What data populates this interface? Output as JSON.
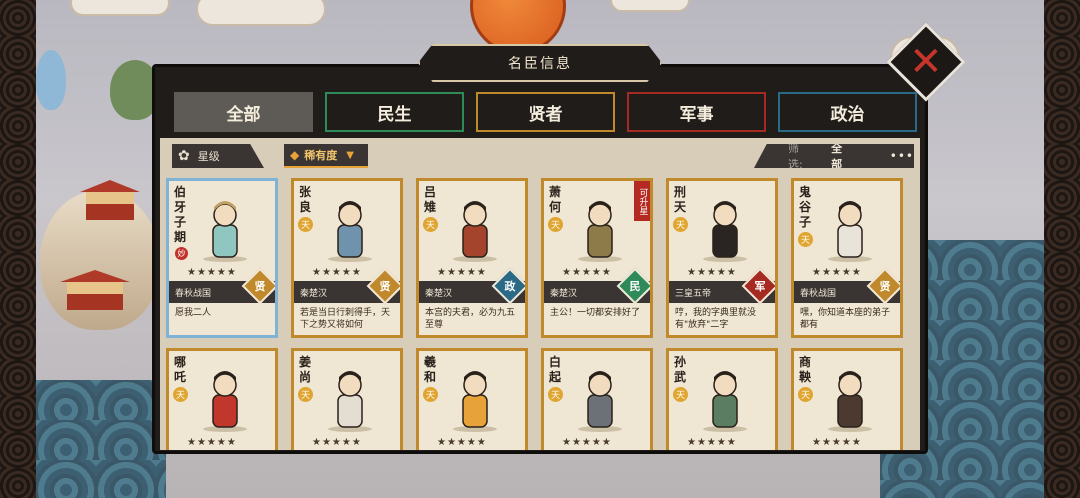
{
  "window_title": "名臣信息",
  "close_icon": "close-x-icon",
  "tabs": [
    {
      "label": "全部",
      "color": "#5e5a55",
      "active": true
    },
    {
      "label": "民生",
      "color": "#2f8a5a",
      "active": false
    },
    {
      "label": "贤者",
      "color": "#c08a2c",
      "active": false
    },
    {
      "label": "军事",
      "color": "#a52a22",
      "active": false
    },
    {
      "label": "政治",
      "color": "#2a6a86",
      "active": false
    }
  ],
  "filters": {
    "star_label": "星级",
    "rarity_label": "稀有度",
    "filter_label": "筛选:",
    "filter_value": "全部",
    "more": "•••"
  },
  "heroes": [
    {
      "name": "伯牙子期",
      "era": "春秋战国",
      "type": "贤",
      "type_color": "#c08a2c",
      "quote": "愿我二人",
      "stars": "★★★★★",
      "tian": "",
      "miao": "妙",
      "upgrade": "",
      "selected": true,
      "colors": [
        "#8fc7c0",
        "#c2a065"
      ]
    },
    {
      "name": "张良",
      "era": "秦楚汉",
      "type": "贤",
      "type_color": "#c08a2c",
      "quote": "若是当日行刺得手，天下之势又将如何",
      "stars": "★★★★★",
      "tian": "天",
      "miao": "",
      "upgrade": "",
      "selected": false,
      "colors": [
        "#6f93ad"
      ]
    },
    {
      "name": "吕雉",
      "era": "秦楚汉",
      "type": "政",
      "type_color": "#2a6a86",
      "quote": "本宫的夫君，必为九五至尊",
      "stars": "★★★★★",
      "tian": "天",
      "miao": "",
      "upgrade": "",
      "selected": false,
      "colors": [
        "#a4442d"
      ]
    },
    {
      "name": "萧何",
      "era": "秦楚汉",
      "type": "民",
      "type_color": "#2f8a5a",
      "quote": "主公！一切都安排好了",
      "stars": "★★★★★",
      "tian": "天",
      "miao": "",
      "upgrade": "可升星",
      "selected": false,
      "colors": [
        "#8d7b4a"
      ]
    },
    {
      "name": "刑天",
      "era": "三皇五帝",
      "type": "军",
      "type_color": "#a52a22",
      "quote": "哼，我的字典里就没有\"放弃\"二字",
      "stars": "★★★★★",
      "tian": "天",
      "miao": "",
      "upgrade": "",
      "selected": false,
      "colors": [
        "#2a2522"
      ]
    },
    {
      "name": "鬼谷子",
      "era": "春秋战国",
      "type": "贤",
      "type_color": "#c08a2c",
      "quote": "嘿，你知道本座的弟子都有",
      "stars": "★★★★★",
      "tian": "天",
      "miao": "",
      "upgrade": "",
      "selected": false,
      "colors": [
        "#e9e4da"
      ]
    },
    {
      "name": "哪吒",
      "era": "",
      "type": "",
      "type_color": "",
      "quote": "",
      "stars": "★★★★★",
      "tian": "天",
      "miao": "",
      "upgrade": "",
      "selected": false,
      "colors": [
        "#c2372c"
      ]
    },
    {
      "name": "姜尚",
      "era": "",
      "type": "",
      "type_color": "",
      "quote": "",
      "stars": "★★★★★",
      "tian": "天",
      "miao": "",
      "upgrade": "",
      "selected": false,
      "colors": [
        "#e3ddd2"
      ]
    },
    {
      "name": "羲和",
      "era": "",
      "type": "",
      "type_color": "",
      "quote": "",
      "stars": "★★★★★",
      "tian": "天",
      "miao": "",
      "upgrade": "",
      "selected": false,
      "colors": [
        "#e8a23a"
      ]
    },
    {
      "name": "白起",
      "era": "",
      "type": "",
      "type_color": "",
      "quote": "",
      "stars": "★★★★★",
      "tian": "天",
      "miao": "",
      "upgrade": "",
      "selected": false,
      "colors": [
        "#6c7178"
      ]
    },
    {
      "name": "孙武",
      "era": "",
      "type": "",
      "type_color": "",
      "quote": "",
      "stars": "★★★★★",
      "tian": "天",
      "miao": "",
      "upgrade": "",
      "selected": false,
      "colors": [
        "#5b7d62"
      ]
    },
    {
      "name": "商鞅",
      "era": "",
      "type": "",
      "type_color": "",
      "quote": "",
      "stars": "★★★★★",
      "tian": "天",
      "miao": "",
      "upgrade": "",
      "selected": false,
      "colors": [
        "#4c3a30"
      ]
    }
  ]
}
